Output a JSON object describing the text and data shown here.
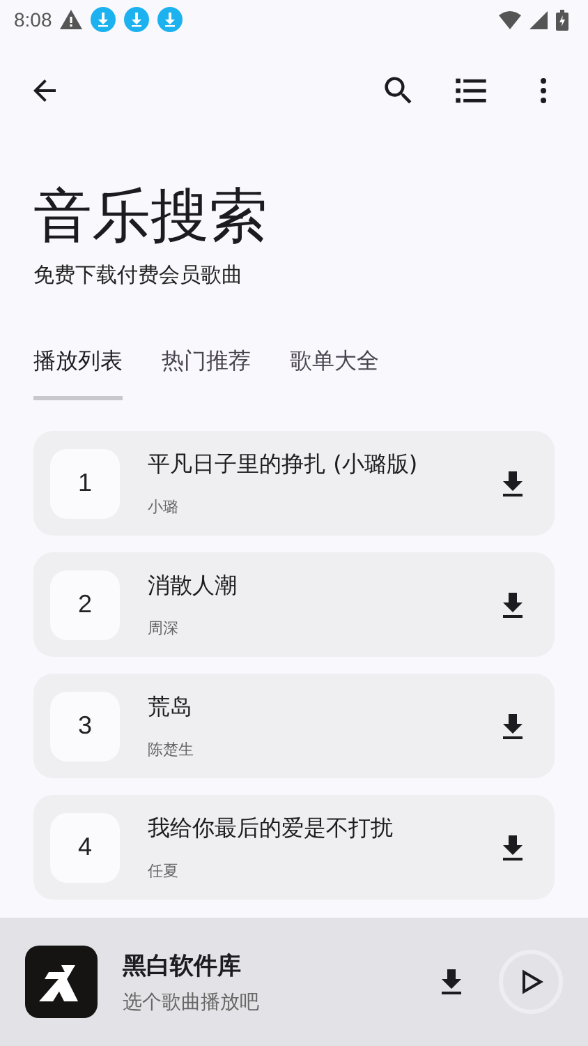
{
  "status_bar": {
    "time": "8:08",
    "notifications": [
      {
        "kind": "warning"
      },
      {
        "kind": "download"
      },
      {
        "kind": "download"
      },
      {
        "kind": "download"
      }
    ]
  },
  "header": {
    "title": "音乐搜索",
    "subtitle": "免费下载付费会员歌曲"
  },
  "tabs": [
    {
      "label": "播放列表",
      "selected": true
    },
    {
      "label": "热门推荐",
      "selected": false
    },
    {
      "label": "歌单大全",
      "selected": false
    }
  ],
  "songs": [
    {
      "number": "1",
      "title": "平凡日子里的挣扎 (小璐版)",
      "artist": "小璐"
    },
    {
      "number": "2",
      "title": "消散人潮",
      "artist": "周深"
    },
    {
      "number": "3",
      "title": "荒岛",
      "artist": "陈楚生"
    },
    {
      "number": "4",
      "title": "我给你最后的爱是不打扰",
      "artist": "任夏"
    }
  ],
  "player": {
    "title": "黑白软件库",
    "subtitle": "选个歌曲播放吧"
  }
}
